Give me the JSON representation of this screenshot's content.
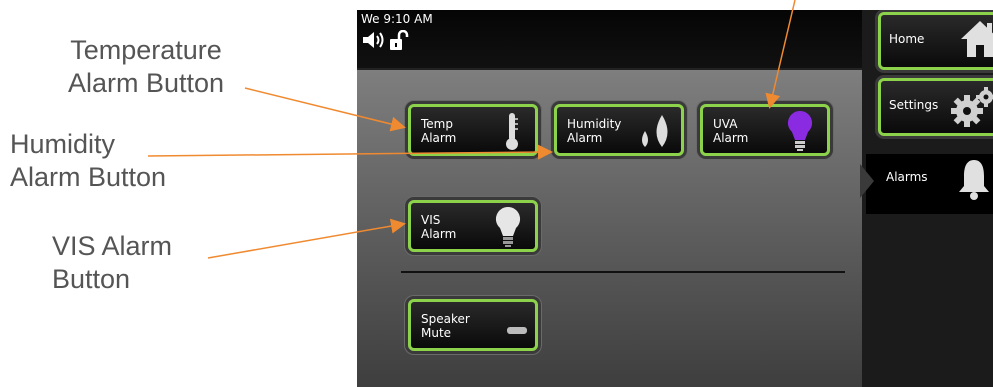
{
  "callouts": {
    "temperature": "Temperature\nAlarm Button",
    "humidity": "Humidity\nAlarm Button",
    "vis": "VIS Alarm\nButton"
  },
  "status": {
    "time": "We 9:10 AM",
    "icons": [
      "speaker-icon",
      "unlocked-padlock-icon"
    ]
  },
  "buttons": {
    "temp": {
      "label": "Temp\nAlarm",
      "icon": "thermometer-icon"
    },
    "humidity": {
      "label": "Humidity\nAlarm",
      "icon": "water-drops-icon"
    },
    "uva": {
      "label": "UVA\nAlarm",
      "icon": "purple-light-bulb-icon"
    },
    "vis": {
      "label": "VIS\nAlarm",
      "icon": "white-light-bulb-icon"
    },
    "speaker": {
      "label": "Speaker\nMute",
      "icon": "toggle-indicator-icon"
    }
  },
  "sidebar": {
    "home": {
      "label": "Home",
      "icon": "house-icon"
    },
    "settings": {
      "label": "Settings",
      "icon": "gears-icon"
    },
    "alarms": {
      "label": "Alarms",
      "icon": "bell-icon"
    }
  },
  "colors": {
    "accent": "#8cd24a",
    "arrow": "#f08a30",
    "uva_bulb": "#8a2be2"
  }
}
